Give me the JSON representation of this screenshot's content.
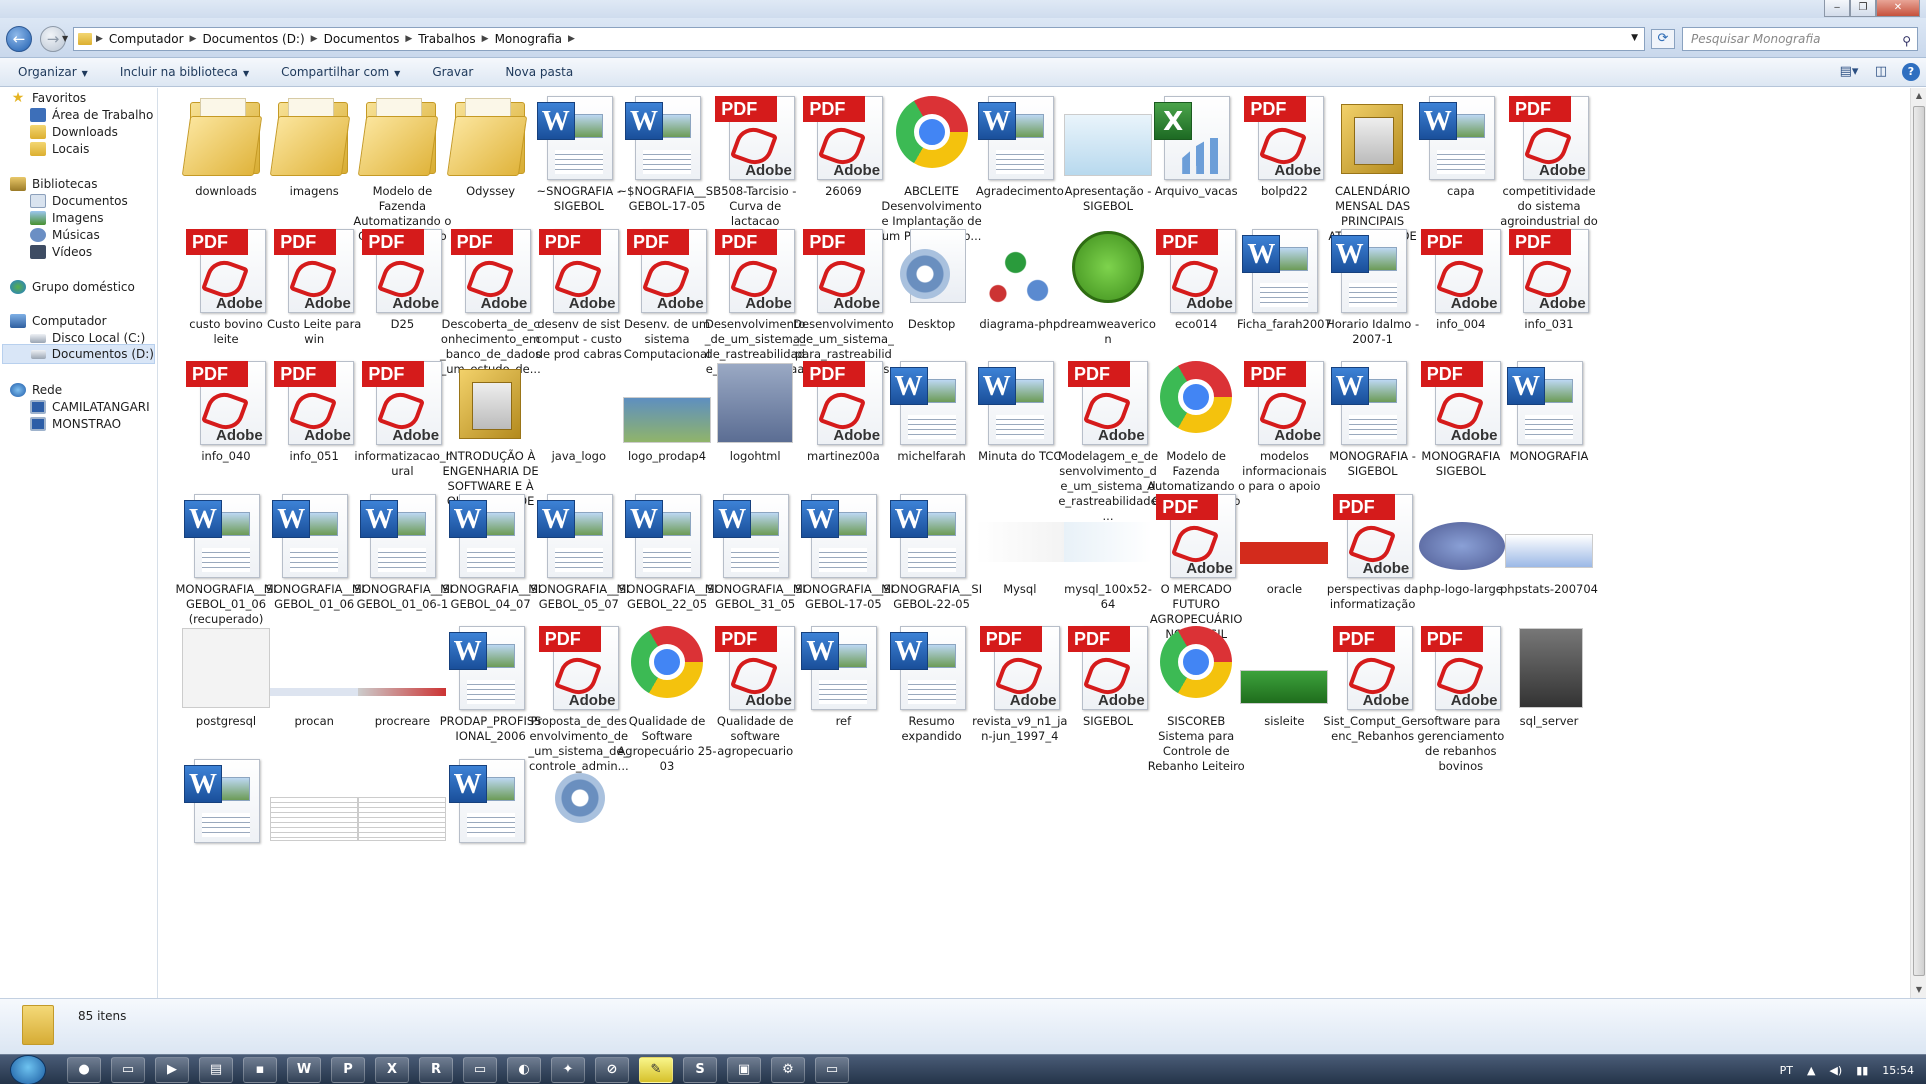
{
  "address": {
    "crumbs": [
      "Computador",
      "Documentos (D:)",
      "Documentos",
      "Trabalhos",
      "Monografia"
    ],
    "search_placeholder": "Pesquisar Monografia"
  },
  "toolbar": {
    "organize": "Organizar",
    "include": "Incluir na biblioteca",
    "share": "Compartilhar com",
    "burn": "Gravar",
    "new_folder": "Nova pasta"
  },
  "sidebar": {
    "favoritos": "Favoritos",
    "area_de_trabalho": "Área de Trabalho",
    "downloads": "Downloads",
    "locais": "Locais",
    "bibliotecas": "Bibliotecas",
    "documentos": "Documentos",
    "imagens": "Imagens",
    "musicas": "Músicas",
    "videos": "Vídeos",
    "grupo": "Grupo doméstico",
    "computador": "Computador",
    "disco_c": "Disco Local (C:)",
    "disco_d": "Documentos (D:)",
    "rede": "Rede",
    "net1": "CAMILATANGARI",
    "net2": "MONSTRAO"
  },
  "files": [
    {
      "name": "downloads",
      "type": "folder"
    },
    {
      "name": "imagens",
      "type": "folder"
    },
    {
      "name": "Modelo de Fazenda Automatizando o Gerenciamento ...",
      "type": "folder"
    },
    {
      "name": "Odyssey",
      "type": "folder"
    },
    {
      "name": "~SNOGRAFIA - SIGEBOL",
      "type": "word"
    },
    {
      "name": "~$NOGRAFIA__SIGEBOL-17-05",
      "type": "word"
    },
    {
      "name": "3508-Tarcisio - Curva de lactacao",
      "type": "pdf"
    },
    {
      "name": "26069",
      "type": "pdf"
    },
    {
      "name": "ABCLEITE Desenvolvimento e Implantação de um Programa p...",
      "type": "chrome"
    },
    {
      "name": "Agradecimento",
      "type": "word"
    },
    {
      "name": "Apresentação - SIGEBOL",
      "type": "ppt"
    },
    {
      "name": "Arquivo_vacas",
      "type": "excel"
    },
    {
      "name": "bolpd22",
      "type": "pdf"
    },
    {
      "name": "CALENDÁRIO MENSAL DAS PRINCIPAIS ATIVIDADES DE ...",
      "type": "frame"
    },
    {
      "name": "capa",
      "type": "word"
    },
    {
      "name": "competitividade do sistema agroindustrial do leite",
      "type": "pdf"
    },
    {
      "name": "custo bovino leite",
      "type": "pdf"
    },
    {
      "name": "Custo Leite para win",
      "type": "pdf"
    },
    {
      "name": "D25",
      "type": "pdf"
    },
    {
      "name": "Descoberta_de_conhecimento_em_banco_de_dados_um_estudo_de...",
      "type": "pdf"
    },
    {
      "name": "desenv de sist comput - custo de prod cabras",
      "type": "pdf"
    },
    {
      "name": "Desenv. de um sistema Computacional",
      "type": "pdf"
    },
    {
      "name": "Desenvolvimento_de_um_sistema_de_rastreabilidade_para_a_cacha...",
      "type": "pdf"
    },
    {
      "name": "Desenvolvimento_de_um_sistema_para_rastreabilidade_de_bovinos",
      "type": "pdf"
    },
    {
      "name": "Desktop",
      "type": "gear"
    },
    {
      "name": "diagrama-php",
      "type": "diagram"
    },
    {
      "name": "dreamweavericon",
      "type": "dream"
    },
    {
      "name": "eco014",
      "type": "pdf"
    },
    {
      "name": "Ficha_farah2007",
      "type": "word"
    },
    {
      "name": "Horario Idalmo - 2007-1",
      "type": "word"
    },
    {
      "name": "info_004",
      "type": "pdf"
    },
    {
      "name": "info_031",
      "type": "pdf"
    },
    {
      "name": "info_040",
      "type": "pdf"
    },
    {
      "name": "info_051",
      "type": "pdf"
    },
    {
      "name": "informatizacao_rural",
      "type": "pdf"
    },
    {
      "name": "INTRODUÇÃO À ENGENHARIA DE SOFTWARE E À QUALIDADE DE ...",
      "type": "frame"
    },
    {
      "name": "java_logo",
      "type": "java"
    },
    {
      "name": "logo_prodap4",
      "type": "prodap"
    },
    {
      "name": "logohtml",
      "type": "html"
    },
    {
      "name": "martinez00a",
      "type": "pdf"
    },
    {
      "name": "michelfarah",
      "type": "word"
    },
    {
      "name": "Minuta do TCC",
      "type": "word"
    },
    {
      "name": "Modelagem_e_desenvolvimento_de_um_sistema_de_rastreabilidade...",
      "type": "pdf"
    },
    {
      "name": "Modelo de Fazenda Automatizando o Gerenciamento ...",
      "type": "chrome"
    },
    {
      "name": "modelos informacionais para o apoio",
      "type": "pdf"
    },
    {
      "name": "MONOGRAFIA - SIGEBOL",
      "type": "word"
    },
    {
      "name": "MONOGRAFIA SIGEBOL",
      "type": "pdf"
    },
    {
      "name": "MONOGRAFIA",
      "type": "word"
    },
    {
      "name": "MONOGRAFIA__SIGEBOL_01_06 (recuperado)",
      "type": "word"
    },
    {
      "name": "MONOGRAFIA__SIGEBOL_01_06",
      "type": "word"
    },
    {
      "name": "MONOGRAFIA__SIGEBOL_01_06-1",
      "type": "word"
    },
    {
      "name": "MONOGRAFIA__SIGEBOL_04_07",
      "type": "word"
    },
    {
      "name": "MONOGRAFIA__SIGEBOL_05_07",
      "type": "word"
    },
    {
      "name": "MONOGRAFIA__SIGEBOL_22_05",
      "type": "word"
    },
    {
      "name": "MONOGRAFIA__SIGEBOL_31_05",
      "type": "word"
    },
    {
      "name": "MONOGRAFIA__SIGEBOL-17-05",
      "type": "word"
    },
    {
      "name": "MONOGRAFIA__SIGEBOL-22-05",
      "type": "word"
    },
    {
      "name": "Mysql",
      "type": "mysql"
    },
    {
      "name": "mysql_100x52-64",
      "type": "mysql2"
    },
    {
      "name": "O MERCADO FUTURO AGROPECUÁRIO NO BRASIL",
      "type": "pdf"
    },
    {
      "name": "oracle",
      "type": "oracle"
    },
    {
      "name": "perspectivas da informatização",
      "type": "pdf"
    },
    {
      "name": "php-logo-large",
      "type": "php"
    },
    {
      "name": "phpstats-200704",
      "type": "stats"
    },
    {
      "name": "postgresql",
      "type": "postgres"
    },
    {
      "name": "procan",
      "type": "procan"
    },
    {
      "name": "procreare",
      "type": "procreare"
    },
    {
      "name": "PRODAP_PROFISSIONAL_2006",
      "type": "word"
    },
    {
      "name": "Proposta_de_desenvolvimento_de_um_sistema_de_controle_admin...",
      "type": "pdf"
    },
    {
      "name": "Qualidade de Software Agropecuário 25-03",
      "type": "chrome"
    },
    {
      "name": "Qualidade de software agropecuario",
      "type": "pdf"
    },
    {
      "name": "ref",
      "type": "word"
    },
    {
      "name": "Resumo expandido",
      "type": "word"
    },
    {
      "name": "revista_v9_n1_jan-jun_1997_4",
      "type": "pdf"
    },
    {
      "name": "SIGEBOL",
      "type": "pdf"
    },
    {
      "name": "SISCOREB Sistema para Controle de Rebanho Leiteiro",
      "type": "chrome"
    },
    {
      "name": "sisleite",
      "type": "sisleite"
    },
    {
      "name": "Sist_Comput_Gerenc_Rebanhos",
      "type": "pdf"
    },
    {
      "name": "software para gerenciamento de rebanhos bovinos",
      "type": "pdf"
    },
    {
      "name": "sql_server",
      "type": "sqlserver"
    },
    {
      "name": "",
      "type": "word"
    },
    {
      "name": "",
      "type": "sheet"
    },
    {
      "name": "",
      "type": "sheet"
    },
    {
      "name": "",
      "type": "word"
    },
    {
      "name": "",
      "type": "gearonly"
    }
  ],
  "status": {
    "count": "85 itens"
  },
  "tray": {
    "lang": "PT",
    "time": "15:54"
  }
}
